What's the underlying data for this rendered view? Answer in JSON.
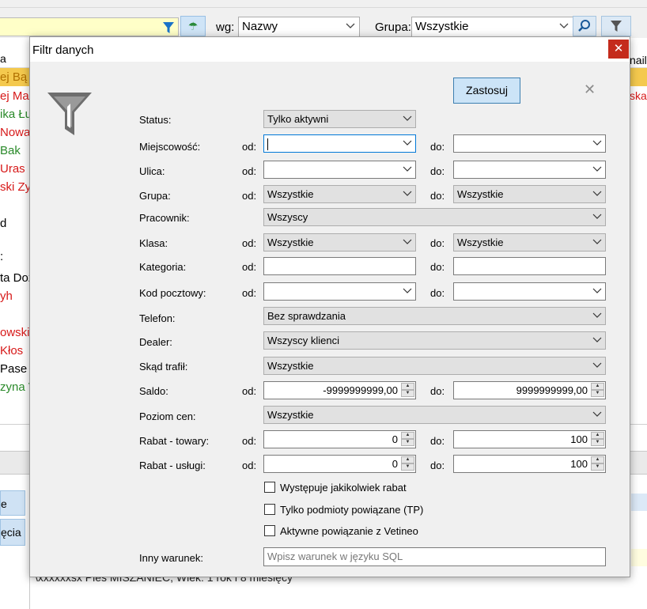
{
  "toolbar": {
    "wg_label": "wg:",
    "wg_value": "Nazwy",
    "grupa_label": "Grupa:",
    "grupa_value": "Wszystkie"
  },
  "background": {
    "col_header_left": "a",
    "col_header_right": "nail",
    "rows": [
      "ej Bą",
      "ej Ma",
      "ika Łu",
      "Nowa",
      "Bak",
      "Uras",
      "ski Zy",
      "d",
      ":",
      "ta Doz",
      "yh",
      "owski",
      "Kłos",
      "Pase",
      "zyna V"
    ],
    "right_red_text": "ska",
    "side_tab_1": "e",
    "side_tab_2": "ęcia",
    "bottom_text": "\\xxxxxxsx    Pies MISZANIEC, Wiek: 1 rok i 8 miesięcy"
  },
  "dialog": {
    "title": "Filtr danych",
    "apply_label": "Zastosuj",
    "od_label": "od:",
    "do_label": "do:",
    "status": {
      "label": "Status:",
      "value": "Tylko aktywni"
    },
    "miejscowosc": {
      "label": "Miejscowość:",
      "from": "",
      "to": ""
    },
    "ulica": {
      "label": "Ulica:",
      "from": "",
      "to": ""
    },
    "grupa": {
      "label": "Grupa:",
      "from": "Wszystkie",
      "to": "Wszystkie"
    },
    "pracownik": {
      "label": "Pracownik:",
      "value": "Wszyscy"
    },
    "klasa": {
      "label": "Klasa:",
      "from": "Wszystkie",
      "to": "Wszystkie"
    },
    "kategoria": {
      "label": "Kategoria:",
      "from": "",
      "to": ""
    },
    "kod_pocztowy": {
      "label": "Kod pocztowy:",
      "from": "",
      "to": ""
    },
    "telefon": {
      "label": "Telefon:",
      "value": "Bez sprawdzania"
    },
    "dealer": {
      "label": "Dealer:",
      "value": "Wszyscy klienci"
    },
    "skad_trafil": {
      "label": "Skąd trafił:",
      "value": "Wszystkie"
    },
    "saldo": {
      "label": "Saldo:",
      "from": "-9999999999,00",
      "to": "9999999999,00"
    },
    "poziom_cen": {
      "label": "Poziom cen:",
      "value": "Wszystkie"
    },
    "rabat_towary": {
      "label": "Rabat - towary:",
      "from": "0",
      "to": "100"
    },
    "rabat_uslugi": {
      "label": "Rabat - usługi:",
      "from": "0",
      "to": "100"
    },
    "checkboxes": [
      {
        "label": "Występuje jakikolwiek rabat",
        "checked": false
      },
      {
        "label": "Tylko podmioty powiązane (TP)",
        "checked": false
      },
      {
        "label": "Aktywne powiązanie z Vetineo",
        "checked": false
      }
    ],
    "inny_warunek": {
      "label": "Inny warunek:",
      "placeholder": "Wpisz warunek w języku SQL"
    }
  }
}
